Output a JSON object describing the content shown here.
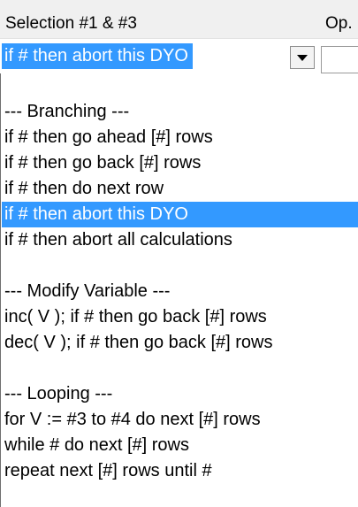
{
  "header": {
    "column1_label": "Selection #1 & #3",
    "column2_label": "Op."
  },
  "combo": {
    "selected_value": "if # then abort this DYO"
  },
  "colors": {
    "selection": "#3399ff",
    "header_bg": "#f0f0f0"
  },
  "dropdown": {
    "items": [
      {
        "label": "",
        "selected": false
      },
      {
        "label": "--- Branching ---",
        "selected": false
      },
      {
        "label": "if # then go ahead [#] rows",
        "selected": false
      },
      {
        "label": "if # then go back [#] rows",
        "selected": false
      },
      {
        "label": "if # then do next row",
        "selected": false
      },
      {
        "label": "if # then abort this DYO",
        "selected": true
      },
      {
        "label": "if # then abort all calculations",
        "selected": false
      },
      {
        "label": "",
        "selected": false
      },
      {
        "label": "--- Modify Variable ---",
        "selected": false
      },
      {
        "label": "inc( V ); if # then go back [#] rows",
        "selected": false
      },
      {
        "label": "dec( V ); if # then go back [#] rows",
        "selected": false
      },
      {
        "label": "",
        "selected": false
      },
      {
        "label": "--- Looping ---",
        "selected": false
      },
      {
        "label": "for V := #3 to #4 do next [#] rows",
        "selected": false
      },
      {
        "label": "while # do next [#] rows",
        "selected": false
      },
      {
        "label": "repeat next [#] rows until #",
        "selected": false
      }
    ]
  }
}
